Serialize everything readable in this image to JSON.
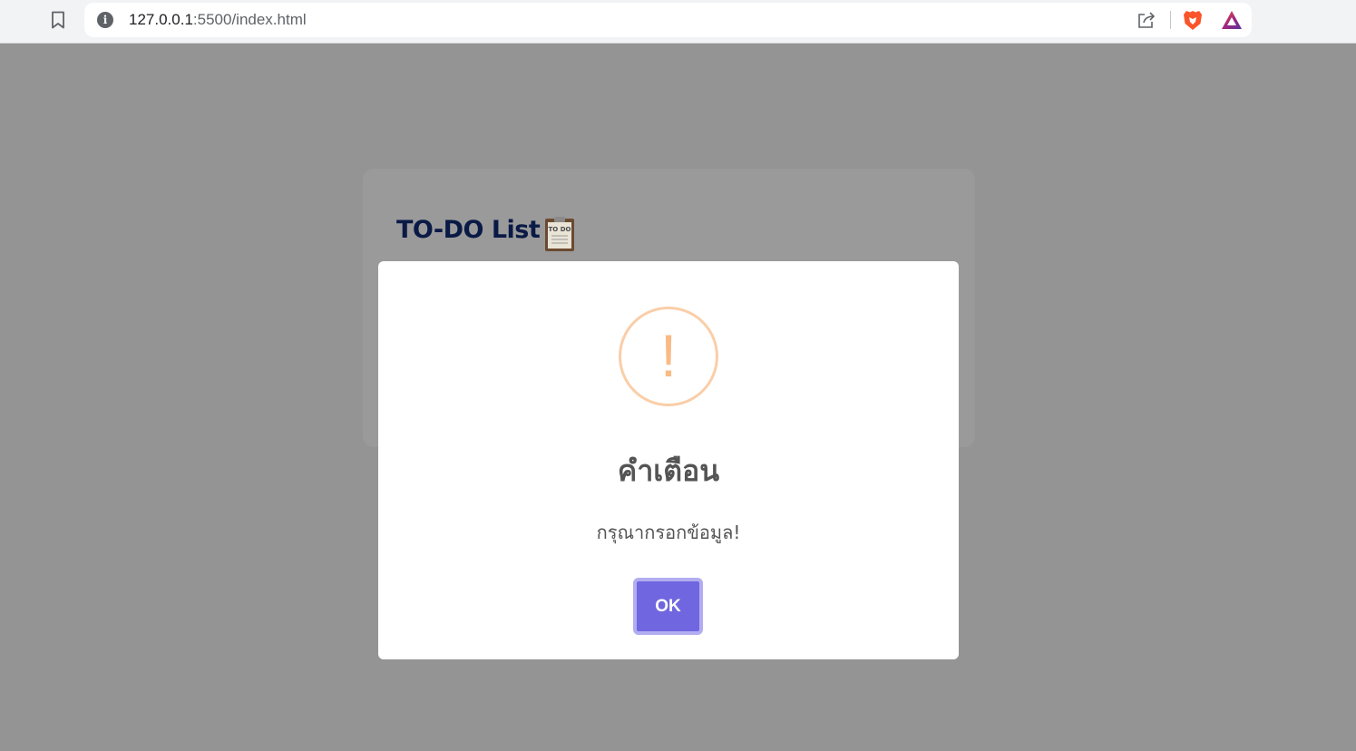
{
  "browser": {
    "url_host": "127.0.0.1",
    "url_rest": ":5500/index.html",
    "icons": [
      "bookmark-icon",
      "site-info-icon",
      "share-icon",
      "brave-shield-icon",
      "brave-rewards-icon"
    ]
  },
  "app": {
    "title": "TO-DO List",
    "title_icon": "clipboard-todo-icon",
    "clipboard_label": "TO DO"
  },
  "dialog": {
    "icon": "warning-icon",
    "icon_symbol": "!",
    "title": "คำเตือน",
    "message": "กรุณากรอกข้อมูล!",
    "confirm_label": "OK",
    "colors": {
      "confirm": "#7066e0",
      "warning": "#f8bb86",
      "text": "#545454"
    }
  }
}
